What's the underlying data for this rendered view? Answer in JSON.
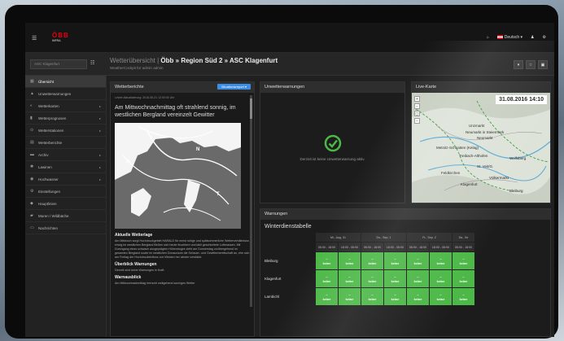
{
  "topbar": {
    "logo_text": "ÖBB",
    "logo_sub": "INFRA",
    "language": "Deutsch"
  },
  "subbar": {
    "location_placeholder": "ASC Klagenfurt",
    "breadcrumb_prefix": "Wetterübersicht |",
    "breadcrumb_main": "Öbb » Region Süd 2 » ASC Klagenfurt",
    "subtitle": "WeatherCockpit für admin admin"
  },
  "sidebar": {
    "items": [
      {
        "label": "Übersicht",
        "icon": "grid-icon",
        "glyph": "▦",
        "active": true,
        "chev": false
      },
      {
        "label": "Unwetterwarnungen",
        "icon": "warning-icon",
        "glyph": "▲",
        "active": false,
        "chev": false
      },
      {
        "label": "Wetterkarten",
        "icon": "globe-icon",
        "glyph": "◐",
        "active": false,
        "chev": true
      },
      {
        "label": "Wetterprognosen",
        "icon": "bar-chart-icon",
        "glyph": "▮",
        "active": false,
        "chev": true
      },
      {
        "label": "Wetterstationen",
        "icon": "station-icon",
        "glyph": "⊙",
        "active": false,
        "chev": true
      },
      {
        "label": "Wetterberichte",
        "icon": "report-icon",
        "glyph": "▤",
        "active": false,
        "chev": false
      },
      {
        "label": "Archiv",
        "icon": "folder-icon",
        "glyph": "▬",
        "active": false,
        "chev": true
      },
      {
        "label": "Lawinen",
        "icon": "snowflake-icon",
        "glyph": "✱",
        "active": false,
        "chev": true
      },
      {
        "label": "Hochwasser",
        "icon": "water-icon",
        "glyph": "◉",
        "active": false,
        "chev": true
      },
      {
        "label": "Einstellungen",
        "icon": "gear-icon",
        "glyph": "⚙",
        "active": false,
        "chev": false
      },
      {
        "label": "Hauptlinien",
        "icon": "pin-icon",
        "glyph": "◆",
        "active": false,
        "chev": false
      },
      {
        "label": "Muren / Wildbäche",
        "icon": "mountain-icon",
        "glyph": "▰",
        "active": false,
        "chev": false
      },
      {
        "label": "Nachrichten",
        "icon": "messages-icon",
        "glyph": "▭",
        "active": false,
        "chev": false
      }
    ]
  },
  "wetterberichte": {
    "title": "Wetterberichte",
    "button": "Situationsreport",
    "meta": "Letzte Aktualisierung: 2016-08-31 12:00:00 Uhr",
    "headline": "Am Mittwochnachmittag oft strahlend sonnig, im westlichen Bergland vereinzelt Gewitter",
    "map_letters": [
      "H",
      "N",
      "T",
      "T"
    ],
    "h_lage": "Aktuelle Wetterlage",
    "p_lage": "Am Mittwoch sorgt Hochdruckgebiet HARALD für meist ruhige und spätsommerliche Wetterverhältnisse, einzig im westlichen Bergland fließen sich heute feuchtere und labil geschichtete Luftmassen. Mit Durchgang eines schwach ausgeprägten Höhentroges zieht am Donnerstag vorübergehend im gesamten Bergland sowie im westlichen Donauraum die Schauer- und Gewitterbereitschaft an, ehe sich am Freitag der Hochdruckeinfluss von Westen her wieder verstärkt.",
    "h_warn": "Überblick Warnungen",
    "p_warn": "Derzeit sind keine Warnungen in Kraft.",
    "h_aus": "Warnausblick",
    "p_aus": "Am Mittwochnachmittag herrscht weitgehend sonniges Wetter"
  },
  "unwetter": {
    "title": "Unwetterwarnungen",
    "message": "Derzeit ist keine Unwetterwarnung aktiv.",
    "status_color": "#4cb847"
  },
  "livekarte": {
    "title": "Live-Karte",
    "datetime": "31.08.2016 14:10",
    "labels": [
      "Unzmarkt",
      "Neumarkt in Steiermark",
      "Neumarkt",
      "Metnitz-Schnatten (Kelag)",
      "Treibach-Althofen",
      "Wolfsberg",
      "St. Veit/G.",
      "Feldkirchen",
      "Völkermarkt",
      "Klagenfurt",
      "Bleiburg"
    ]
  },
  "warnungen": {
    "title": "Warnungen",
    "subtitle": "Winterdienstabelle",
    "days": [
      "Mi., Aug. 31",
      "Do., Sep. 1",
      "Fr., Sep. 2",
      "Sa., Se"
    ],
    "times": [
      "06:00 - 18:00",
      "18:00 - 06:00",
      "06:00 - 18:00",
      "18:00 - 06:00",
      "06:00 - 18:00",
      "18:00 - 06:00",
      "06:00 - 18:00"
    ],
    "rows": [
      {
        "location": "Bleiburg",
        "cells": [
          "keine",
          "keine",
          "keine",
          "keine",
          "keine",
          "keine",
          "keine"
        ]
      },
      {
        "location": "Klagenfurt",
        "cells": [
          "keine",
          "keine",
          "keine",
          "keine",
          "keine",
          "keine",
          "keine"
        ]
      },
      {
        "location": "Lambichl",
        "cells": [
          "keine",
          "keine",
          "keine",
          "keine",
          "keine",
          "keine",
          "keine"
        ]
      }
    ],
    "cell_dash": "--",
    "cell_color": "#4cb847"
  }
}
